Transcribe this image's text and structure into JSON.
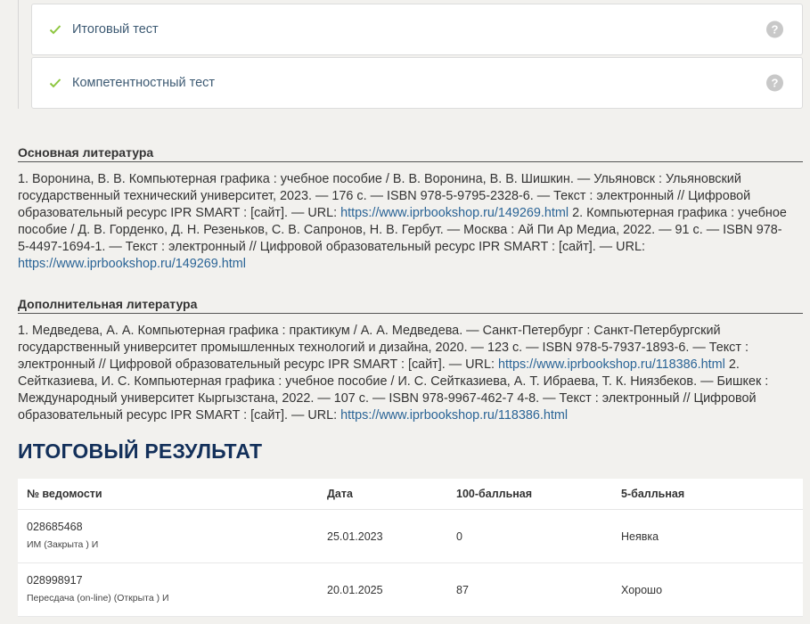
{
  "tests": [
    {
      "label": "Итоговый тест",
      "help": "?"
    },
    {
      "label": "Компетентностный тест",
      "help": "?"
    }
  ],
  "main_lit": {
    "title": "Основная литература",
    "p1": "1. Воронина, В. В. Компьютерная графика : учебное пособие / В. В. Воронина, В. В. Шишкин. — Ульяновск : Ульяновский государственный технический университет, 2023. — 176 с. — ISBN 978-5-9795-2328-6. — Текст : электронный // Цифровой образовательный ресурс IPR SMART : [сайт]. — URL: ",
    "link1": "https://www.iprbookshop.ru/149269.html",
    "p2": " 2. Компьютерная графика : учебное пособие / Д. В. Горденко, Д. Н. Резеньков, С. В. Сапронов, Н. В. Гербут. — Москва : Ай Пи Ар Медиа, 2022. — 91 с. — ISBN 978-5-4497-1694-1. — Текст : электронный // Цифровой образовательный ресурс IPR SMART : [сайт]. — URL: ",
    "link2": "https://www.iprbookshop.ru/149269.html"
  },
  "extra_lit": {
    "title": "Дополнительная литература",
    "p1": "1. Медведева, А. А. Компьютерная графика : практикум / А. А. Медведева. — Санкт-Петербург : Санкт-Петербургский государственный университет промышленных технологий и дизайна, 2020. — 123 с. — ISBN 978-5-7937-1893-6. — Текст : электронный // Цифровой образовательный ресурс IPR SMART : [сайт]. — URL: ",
    "link1": "https://www.iprbookshop.ru/118386.html",
    "p2": " 2. Сейтказиева, И. С. Компьютерная графика : учебное пособие / И. С. Сейтказиева, А. Т. Ибраева, Т. К. Ниязбеков. — Бишкек : Международный университет Кыргызстана, 2022. — 107 с. — ISBN 978-9967-462-7 4-8. — Текст : электронный // Цифровой образовательный ресурс IPR SMART : [сайт]. — URL: ",
    "link2": "https://www.iprbookshop.ru/118386.html"
  },
  "result": {
    "title": "ИТОГОВЫЙ РЕЗУЛЬТАТ",
    "headers": [
      "№ ведомости",
      "Дата",
      "100-балльная",
      "5-балльная"
    ],
    "rows": [
      {
        "number": "028685468",
        "type": "ИМ (Закрыта ) И",
        "date": "25.01.2023",
        "score100": "0",
        "score5": "Неявка"
      },
      {
        "number": "028998917",
        "type": "Пересдача (on-line) (Открыта ) И",
        "date": "20.01.2025",
        "score100": "87",
        "score5": "Хорошо"
      }
    ]
  },
  "colors": {
    "accent": "#8dc63f",
    "heading": "#13305a",
    "link": "#2a6496"
  }
}
